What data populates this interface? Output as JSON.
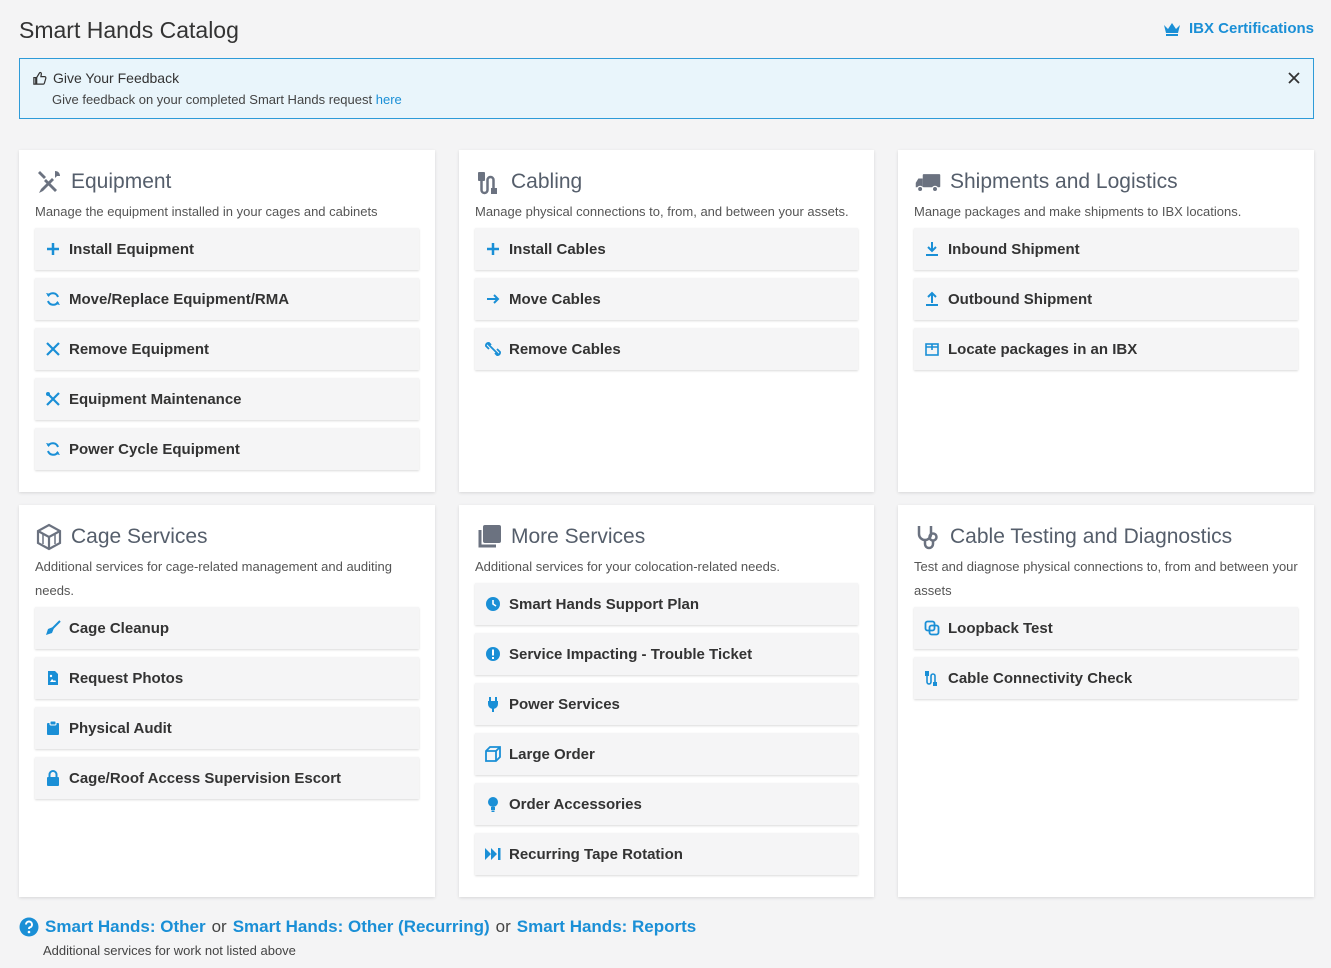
{
  "page": {
    "title": "Smart Hands Catalog",
    "ibx_certifications": "IBX Certifications"
  },
  "feedback": {
    "title": "Give Your Feedback",
    "text": "Give feedback on your completed Smart Hands request ",
    "link": "here"
  },
  "cards": {
    "equipment": {
      "title": "Equipment",
      "desc": "Manage the equipment installed in your cages and cabinets",
      "items": [
        "Install Equipment",
        "Move/Replace Equipment/RMA",
        "Remove Equipment",
        "Equipment Maintenance",
        "Power Cycle Equipment"
      ]
    },
    "cabling": {
      "title": "Cabling",
      "desc": "Manage physical connections to, from, and between your assets.",
      "items": [
        "Install Cables",
        "Move Cables",
        "Remove Cables"
      ]
    },
    "shipments": {
      "title": "Shipments and Logistics",
      "desc": "Manage packages and make shipments to IBX locations.",
      "items": [
        "Inbound Shipment",
        "Outbound Shipment",
        "Locate packages in an IBX"
      ]
    },
    "cage": {
      "title": "Cage Services",
      "desc": "Additional services for cage-related management and auditing needs.",
      "items": [
        "Cage Cleanup",
        "Request Photos",
        "Physical Audit",
        "Cage/Roof Access Supervision Escort"
      ]
    },
    "more": {
      "title": "More Services",
      "desc": "Additional services for your colocation-related needs.",
      "items": [
        "Smart Hands Support Plan",
        "Service Impacting - Trouble Ticket",
        "Power Services",
        "Large Order",
        "Order Accessories",
        "Recurring Tape Rotation"
      ]
    },
    "testing": {
      "title": "Cable Testing and Diagnostics",
      "desc": "Test and diagnose physical connections to, from and between your assets",
      "items": [
        "Loopback Test",
        "Cable Connectivity Check"
      ]
    }
  },
  "footer": {
    "link_other": "Smart Hands: Other",
    "or": "or",
    "link_recurring": "Smart Hands: Other (Recurring)",
    "link_reports": "Smart Hands: Reports",
    "desc": "Additional services for work not listed above"
  },
  "colors": {
    "accent": "#1a8fd6",
    "heading_icon": "#6b7280",
    "background": "#f4f4f5"
  }
}
